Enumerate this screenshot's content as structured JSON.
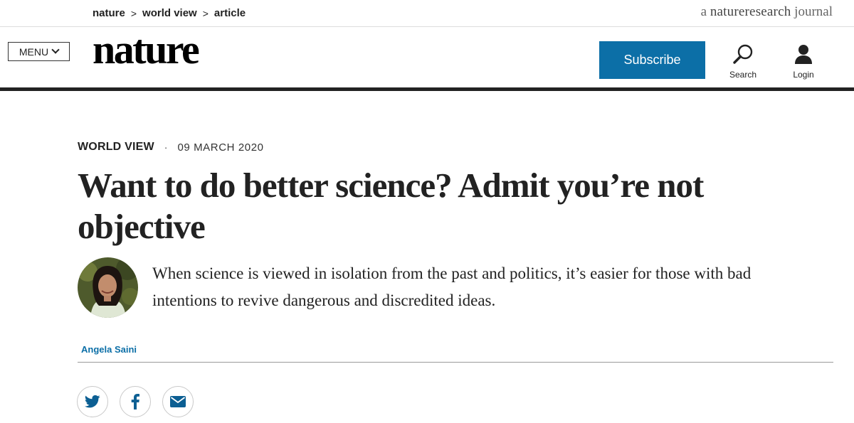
{
  "breadcrumb": {
    "items": [
      "nature",
      "world view",
      "article"
    ],
    "separator": ">"
  },
  "journal_tag": {
    "prefix": "a",
    "brand_a": "nature",
    "brand_b": "research",
    "suffix": "journal"
  },
  "header": {
    "menu_label": "MENU",
    "logo_text": "nature",
    "subscribe_label": "Subscribe",
    "search_label": "Search",
    "login_label": "Login"
  },
  "article": {
    "type": "WORLD VIEW",
    "separator": "·",
    "date": "09 MARCH 2020",
    "title": "Want to do better science? Admit you’re not objective",
    "standfirst": "When science is viewed in isolation from the past and politics, it’s easier for those with bad intentions to revive dangerous and discredited ideas.",
    "author": "Angela Saini"
  },
  "share": {
    "icons": [
      "twitter-icon",
      "facebook-icon",
      "email-icon"
    ]
  },
  "colors": {
    "accent": "#0c6fa7",
    "text": "#222222",
    "rule": "#222222"
  }
}
